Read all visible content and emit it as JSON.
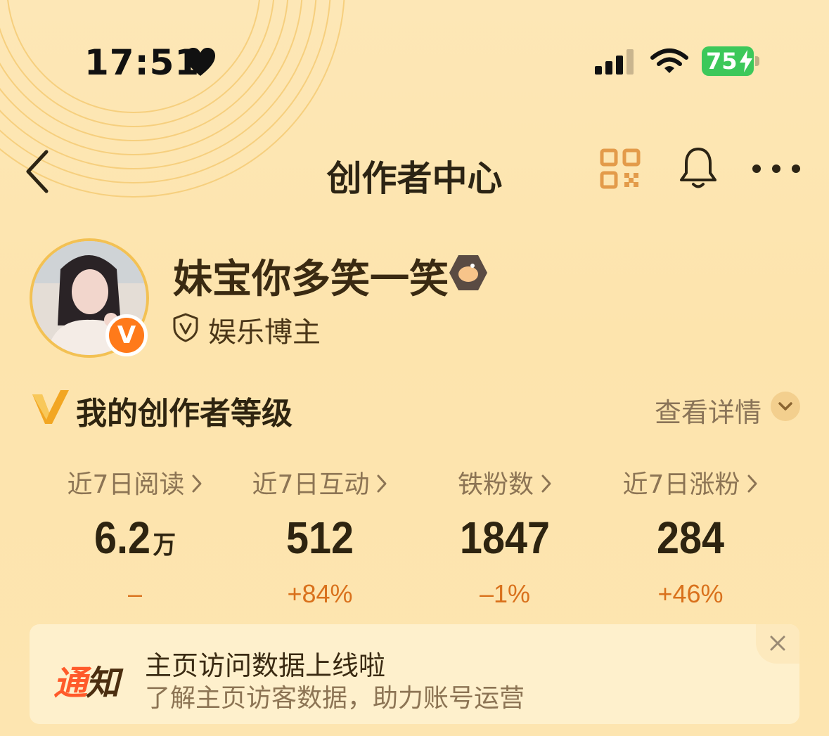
{
  "status_bar": {
    "time": "17:51",
    "battery": "75",
    "icons": [
      "heart-icon",
      "signal-icon",
      "wifi-icon",
      "battery-icon",
      "charging-icon"
    ]
  },
  "nav": {
    "title": "创作者中心",
    "icons": [
      "back-icon",
      "qr-code-icon",
      "bell-icon",
      "more-icon"
    ]
  },
  "profile": {
    "username": "妹宝你多笑一笑",
    "role": "娱乐博主",
    "verified_badge": "V"
  },
  "level": {
    "title": "我的创作者等级",
    "details_label": "查看详情"
  },
  "stats": [
    {
      "label": "近7日阅读",
      "value": "6.2",
      "unit": "万",
      "change": "–"
    },
    {
      "label": "近7日互动",
      "value": "512",
      "unit": "",
      "change": "+84%"
    },
    {
      "label": "铁粉数",
      "value": "1847",
      "unit": "",
      "change": "–1%"
    },
    {
      "label": "近7日涨粉",
      "value": "284",
      "unit": "",
      "change": "+46%"
    }
  ],
  "notice": {
    "tag_part1": "通",
    "tag_part2": "知",
    "title": "主页访问数据上线啦",
    "subtitle": "了解主页访客数据，助力账号运营"
  },
  "colors": {
    "background": "#fde5b0",
    "accent_orange": "#d9711c",
    "badge_orange": "#ff7a1a",
    "battery_green": "#3cc85a"
  }
}
